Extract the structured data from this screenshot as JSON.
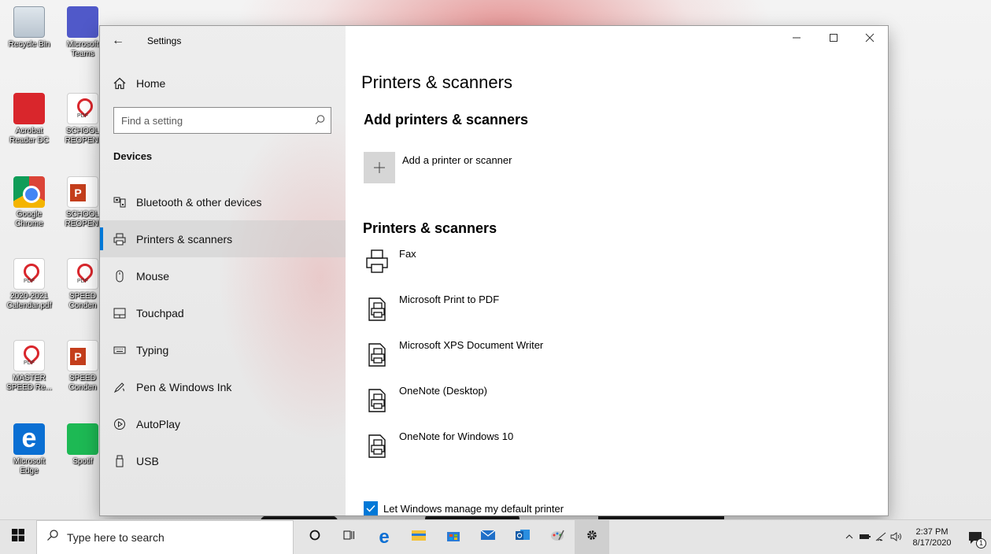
{
  "desktop": {
    "icons": [
      {
        "label": "Recycle Bin"
      },
      {
        "label": "Microsoft Teams"
      },
      {
        "label": "Acrobat Reader DC"
      },
      {
        "label": "SCHOOL REOPENI"
      },
      {
        "label": "Google Chrome"
      },
      {
        "label": "SCHOOL REOPENI"
      },
      {
        "label": "2020-2021 Calendar.pdf"
      },
      {
        "label": "SPEED Conden"
      },
      {
        "label": "MASTER SPEED Re..."
      },
      {
        "label": "SPEED Conden"
      },
      {
        "label": "Microsoft Edge"
      },
      {
        "label": "Spotif"
      }
    ]
  },
  "window": {
    "title": "Settings",
    "controls": {
      "minimize": "minimize-icon",
      "maximize": "maximize-icon",
      "close": "close-icon"
    }
  },
  "sidebar": {
    "home_label": "Home",
    "search_placeholder": "Find a setting",
    "section_heading": "Devices",
    "items": [
      {
        "label": "Bluetooth & other devices",
        "icon": "bluetooth-devices-icon"
      },
      {
        "label": "Printers & scanners",
        "icon": "printer-icon",
        "active": true
      },
      {
        "label": "Mouse",
        "icon": "mouse-icon"
      },
      {
        "label": "Touchpad",
        "icon": "touchpad-icon"
      },
      {
        "label": "Typing",
        "icon": "keyboard-icon"
      },
      {
        "label": "Pen & Windows Ink",
        "icon": "pen-icon"
      },
      {
        "label": "AutoPlay",
        "icon": "autoplay-icon"
      },
      {
        "label": "USB",
        "icon": "usb-icon"
      }
    ]
  },
  "main": {
    "title": "Printers & scanners",
    "add_heading": "Add printers & scanners",
    "add_label": "Add a printer or scanner",
    "list_heading": "Printers & scanners",
    "printers": [
      {
        "name": "Fax"
      },
      {
        "name": "Microsoft Print to PDF"
      },
      {
        "name": "Microsoft XPS Document Writer"
      },
      {
        "name": "OneNote (Desktop)"
      },
      {
        "name": "OneNote for Windows 10"
      }
    ],
    "default_printer_label": "Let Windows manage my default printer",
    "default_printer_checked": true
  },
  "taskbar": {
    "search_text": "Type here to search",
    "apps": [
      "cortana-icon",
      "task-view-icon",
      "edge-icon",
      "file-explorer-icon",
      "store-icon",
      "mail-icon",
      "outlook-icon",
      "paint-icon",
      "settings-icon"
    ],
    "time": "2:37 PM",
    "date": "8/17/2020",
    "notification_count": "1"
  },
  "colors": {
    "accent": "#0078d7",
    "taskbar": "#e5e5e5",
    "sidebar": "#e6e6e6"
  }
}
